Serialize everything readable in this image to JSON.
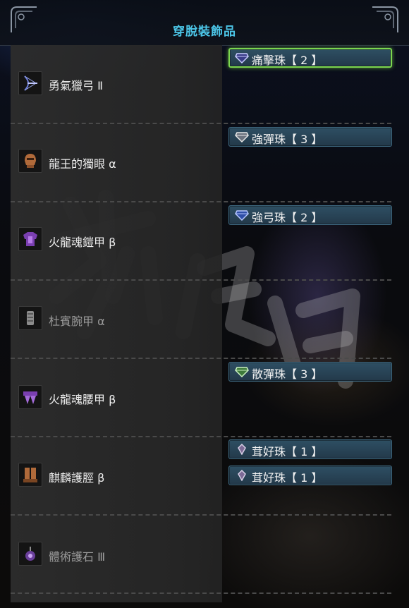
{
  "header": {
    "title": "穿脫裝飾品"
  },
  "equipment": [
    {
      "icon": "bow-weapon-icon",
      "name": "勇氣獵弓 Ⅱ",
      "dim": false,
      "decorations": [
        {
          "name": "痛擊珠【 2 】",
          "gem": "white",
          "selected": true
        }
      ]
    },
    {
      "icon": "helm-icon",
      "name": "龍王的獨眼 α",
      "dim": false,
      "decorations": [
        {
          "name": "強彈珠【 3 】",
          "gem": "white",
          "selected": false
        }
      ]
    },
    {
      "icon": "chest-armor-icon",
      "name": "火龍魂鎧甲 β",
      "dim": false,
      "decorations": [
        {
          "name": "強弓珠【 2 】",
          "gem": "blue",
          "selected": false
        }
      ]
    },
    {
      "icon": "arm-armor-icon",
      "name": "杜賓腕甲 α",
      "dim": true,
      "decorations": []
    },
    {
      "icon": "waist-armor-icon",
      "name": "火龍魂腰甲 β",
      "dim": false,
      "decorations": [
        {
          "name": "散彈珠【 3 】",
          "gem": "green",
          "selected": false
        }
      ]
    },
    {
      "icon": "leg-armor-icon",
      "name": "麒麟護脛 β",
      "dim": false,
      "decorations": [
        {
          "name": "茸好珠【 1 】",
          "gem": "grey",
          "selected": false
        },
        {
          "name": "茸好珠【 1 】",
          "gem": "grey",
          "selected": false
        }
      ]
    },
    {
      "icon": "charm-icon",
      "name": "體術護石 Ⅲ",
      "dim": true,
      "decorations": []
    }
  ],
  "colors": {
    "title": "#4cc6e8",
    "selection": "#7cd64e",
    "slot_fill": "#2e4f63"
  }
}
